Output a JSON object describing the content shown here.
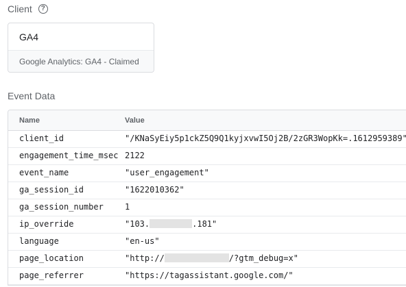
{
  "client_section": {
    "title": "Client",
    "help_icon": "help-circle-icon",
    "card_name": "GA4",
    "card_description": "Google Analytics: GA4 - Claimed"
  },
  "event_section": {
    "title": "Event Data",
    "columns": [
      "Name",
      "Value"
    ],
    "rows": [
      {
        "name": "client_id",
        "value": "\"/KNaSyEiy5p1ckZ5Q9Q1kyjxvwI5Oj2B/2zGR3WopKk=.1612959389\""
      },
      {
        "name": "engagement_time_msec",
        "value": "2122"
      },
      {
        "name": "event_name",
        "value": "\"user_engagement\""
      },
      {
        "name": "ga_session_id",
        "value": "\"1622010362\""
      },
      {
        "name": "ga_session_number",
        "value": "1"
      },
      {
        "name": "ip_override",
        "value_prefix": "\"103.",
        "value_suffix": ".181\""
      },
      {
        "name": "language",
        "value": "\"en-us\""
      },
      {
        "name": "page_location",
        "value_prefix": "\"http://",
        "value_suffix": "/?gtm_debug=x\""
      },
      {
        "name": "page_referrer",
        "value": "\"https://tagassistant.google.com/\""
      }
    ]
  },
  "colors": {
    "border": "#dadce0",
    "header_bg": "#f8f9fa",
    "text_primary": "#202124",
    "text_secondary": "#5f6368",
    "redaction": "#e3e3e3"
  }
}
